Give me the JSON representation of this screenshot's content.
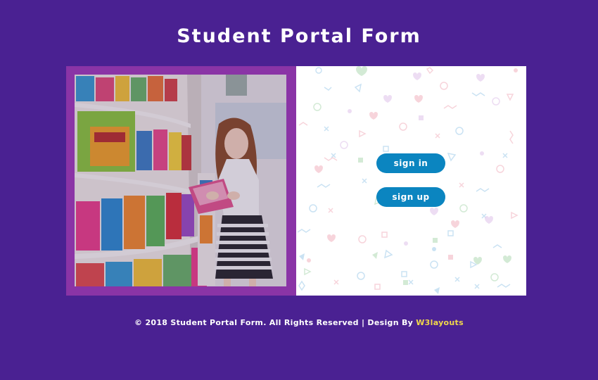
{
  "page": {
    "title": "Student Portal Form"
  },
  "auth": {
    "signin_label": "sign in",
    "signup_label": "sign up"
  },
  "footer": {
    "copyright": "© 2018 Student Portal Form. All Rights Reserved | Design By",
    "designer": "W3layouts"
  },
  "colors": {
    "background": "#4a2192",
    "frame": "#8a34a6",
    "button": "#0b85c0",
    "link": "#f1d84a"
  }
}
